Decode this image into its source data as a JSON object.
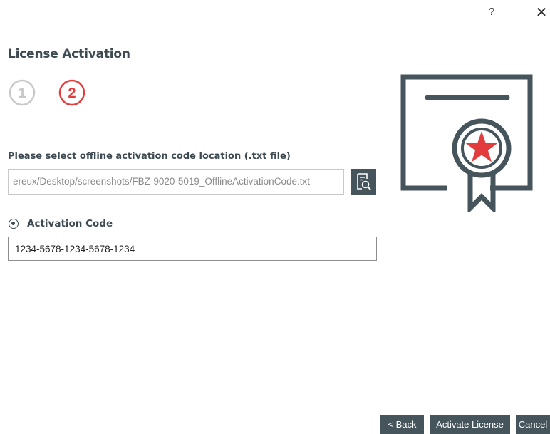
{
  "titlebar": {
    "help_label": "?",
    "close_label": "✕"
  },
  "page": {
    "title": "License Activation"
  },
  "steps": [
    {
      "number": "1",
      "state": "inactive",
      "color": "#c8c8c8"
    },
    {
      "number": "2",
      "state": "active",
      "color": "#e23c3c"
    }
  ],
  "file_section": {
    "label": "Please select offline activation code location (.txt file)",
    "path_value": "ereux/Desktop/screenshots/FBZ-9020-5019_OfflineActivationCode.txt",
    "browse_icon": "file-search-icon"
  },
  "code_section": {
    "radio_label": "Activation Code",
    "selected": true,
    "code_value": "1234-5678-1234-5678-1234"
  },
  "illustration": {
    "icon": "certificate-icon",
    "frame_color": "#46545c",
    "star_color": "#e23c3c"
  },
  "footer": {
    "back_label": "< Back",
    "activate_label": "Activate License",
    "cancel_label": "Cancel"
  }
}
